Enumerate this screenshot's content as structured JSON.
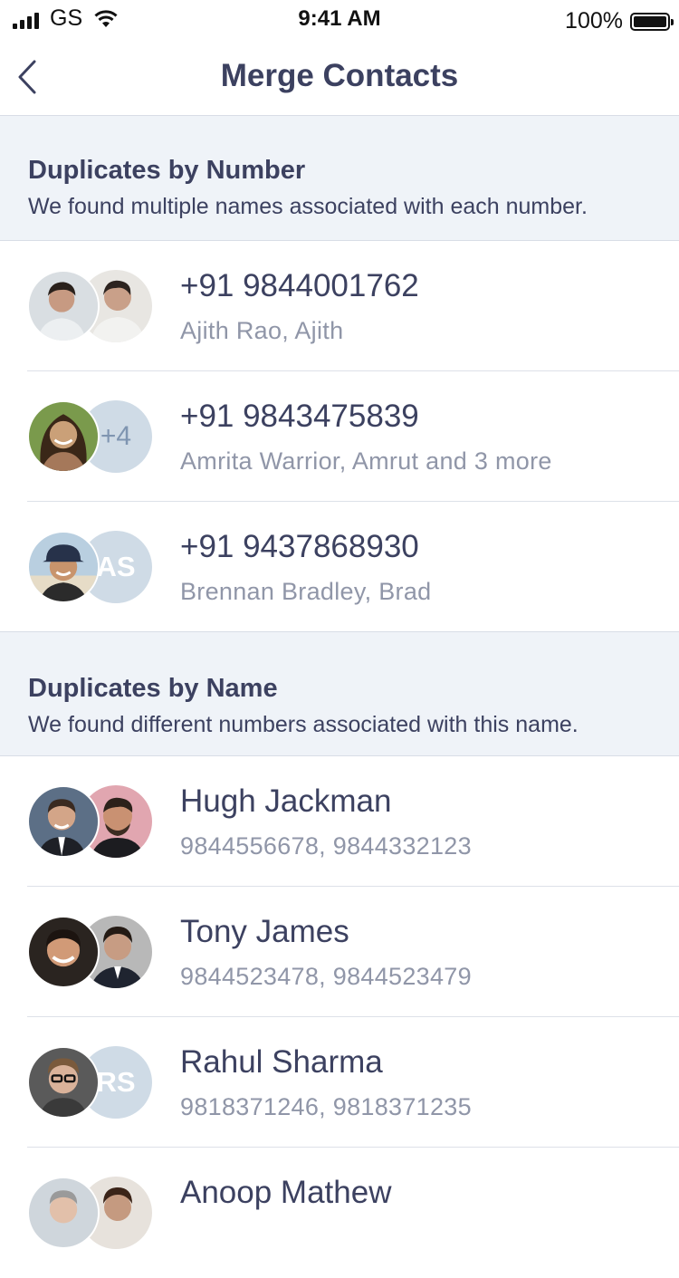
{
  "status_bar": {
    "carrier": "GS",
    "time": "9:41 AM",
    "battery": "100%"
  },
  "nav": {
    "title": "Merge Contacts",
    "back_icon": "chevron-left-icon"
  },
  "sections": [
    {
      "title": "Duplicates by Number",
      "subtitle": "We found multiple names associated with each number.",
      "rows": [
        {
          "title": "+91 9844001762",
          "subtitle": "Ajith Rao, Ajith",
          "badge": ""
        },
        {
          "title": "+91 9843475839",
          "subtitle": "Amrita Warrior, Amrut and 3 more",
          "badge": "+4"
        },
        {
          "title": "+91 9437868930",
          "subtitle": "Brennan Bradley, Brad",
          "badge": "AS"
        }
      ]
    },
    {
      "title": "Duplicates by Name",
      "subtitle": "We found different numbers associated with this name.",
      "rows": [
        {
          "title": "Hugh Jackman",
          "subtitle": "9844556678, 9844332123",
          "badge": ""
        },
        {
          "title": "Tony James",
          "subtitle": "9844523478, 9844523479",
          "badge": ""
        },
        {
          "title": "Rahul Sharma",
          "subtitle": "9818371246, 9818371235",
          "badge": "RS"
        },
        {
          "title": "Anoop Mathew",
          "subtitle": "",
          "badge": ""
        }
      ]
    }
  ],
  "colors": {
    "text": "#3c4160",
    "secondary_text": "#9096a8",
    "section_bg": "#eff3f8",
    "avatar_placeholder": "#cfdbe6"
  }
}
